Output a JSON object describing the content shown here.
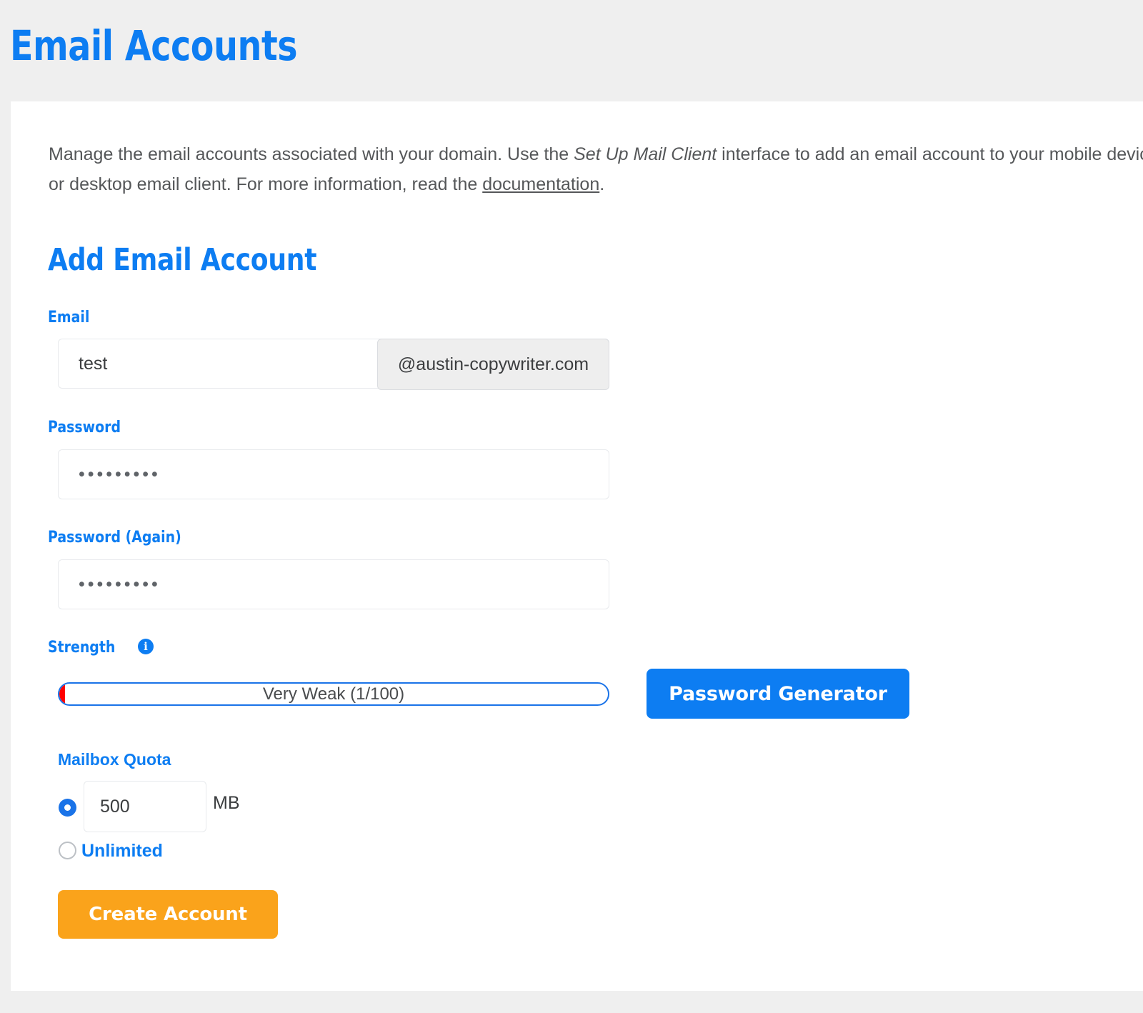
{
  "header": {
    "title": "Email Accounts"
  },
  "description": {
    "part1": "Manage the email accounts associated with your domain. Use the ",
    "emphasis": "Set Up Mail Client",
    "part2": " interface to add an email account to your mobile device or desktop email client. For more information, read the ",
    "link": "documentation",
    "part3": "."
  },
  "form": {
    "section_title": "Add Email Account",
    "email": {
      "label": "Email",
      "value": "test",
      "placeholder": "",
      "domain_suffix": "@austin-copywriter.com"
    },
    "password": {
      "label": "Password",
      "value": "•••••••••",
      "placeholder": ""
    },
    "password_again": {
      "label": "Password (Again)",
      "value": "•••••••••",
      "placeholder": ""
    },
    "strength": {
      "label": "Strength",
      "info_icon": "info-icon",
      "text": "Very Weak (1/100)",
      "score": 1,
      "max": 100,
      "fill_color": "#ff0000",
      "border_color": "#1a73e8"
    },
    "password_generator_button": "Password Generator",
    "quota": {
      "label": "Mailbox Quota",
      "value": "500",
      "unit": "MB",
      "selected_option": "fixed",
      "unlimited_label": "Unlimited"
    },
    "submit_button": "Create Account"
  },
  "colors": {
    "accent": "#0d7df2",
    "warning": "#faa31b",
    "danger": "#ff0000",
    "page_background": "#efefef",
    "card_background": "#ffffff",
    "body_text": "#555759"
  }
}
